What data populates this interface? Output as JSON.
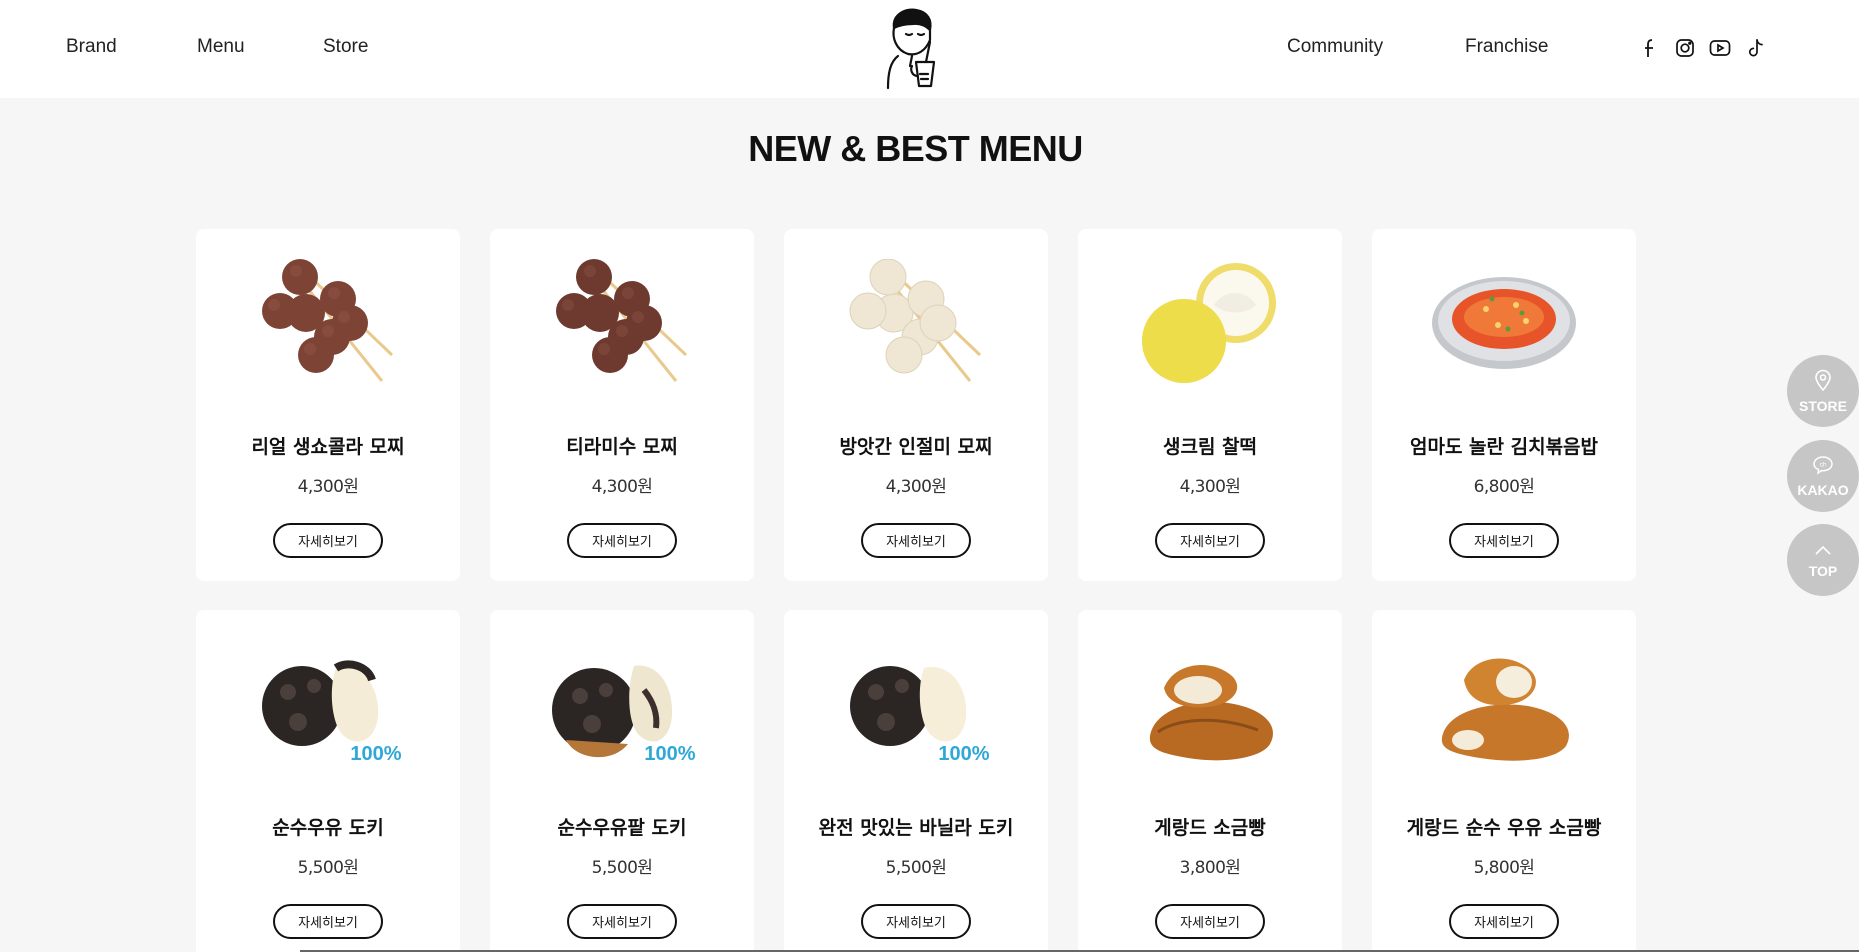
{
  "nav": {
    "left": [
      "Brand",
      "Menu",
      "Store"
    ],
    "right": [
      "Community",
      "Franchise"
    ]
  },
  "social": [
    "facebook-icon",
    "instagram-icon",
    "youtube-icon",
    "tiktok-icon"
  ],
  "page_title": "NEW & BEST MENU",
  "detail_label": "자세히보기",
  "products": [
    {
      "name": "리얼 생쇼콜라 모찌",
      "price": "4,300원",
      "image": "chocolate-mochi-skewer"
    },
    {
      "name": "티라미수 모찌",
      "price": "4,300원",
      "image": "tiramisu-mochi-skewer"
    },
    {
      "name": "방앗간 인절미 모찌",
      "price": "4,300원",
      "image": "injeolmi-mochi-skewer"
    },
    {
      "name": "생크림 찰떡",
      "price": "4,300원",
      "image": "cream-chaltteok"
    },
    {
      "name": "엄마도 놀란 김치볶음밥",
      "price": "6,800원",
      "image": "kimchi-fried-rice"
    },
    {
      "name": "순수우유 도키",
      "price": "5,500원",
      "image": "milk-doki",
      "badge": "100%"
    },
    {
      "name": "순수우유팥 도키",
      "price": "5,500원",
      "image": "milk-redbean-doki",
      "badge": "100%"
    },
    {
      "name": "완전 맛있는 바닐라 도키",
      "price": "5,500원",
      "image": "vanilla-doki",
      "badge": "100%"
    },
    {
      "name": "게랑드 소금빵",
      "price": "3,800원",
      "image": "salt-bread"
    },
    {
      "name": "게랑드 순수 우유 소금빵",
      "price": "5,800원",
      "image": "milk-salt-bread"
    }
  ],
  "float_buttons": {
    "store": "STORE",
    "kakao": "KAKAO",
    "top": "TOP"
  },
  "colors": {
    "background": "#f6f6f6",
    "card": "#ffffff",
    "float_button": "#c6c6c6",
    "text": "#111111"
  }
}
